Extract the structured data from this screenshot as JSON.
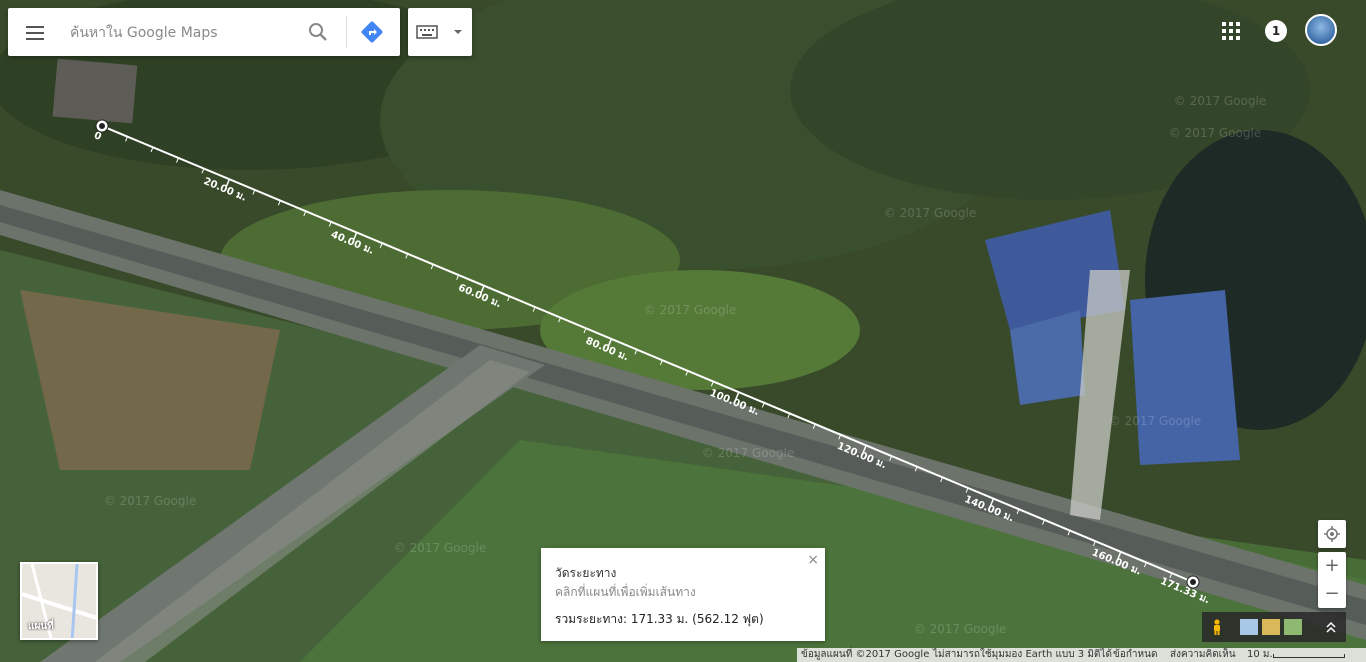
{
  "search": {
    "placeholder": "ค้นหาใน Google Maps"
  },
  "notifications": {
    "count": "1"
  },
  "measure": {
    "title": "วัดระยะทาง",
    "hint": "คลิกที่แผนที่เพื่อเพิ่มเส้นทาง",
    "total": "รวมระยะทาง: 171.33 ม. (562.12 ฟุต)",
    "close": "×",
    "ticks": [
      "0",
      "20.00 ม.",
      "40.00 ม.",
      "60.00 ม.",
      "80.00 ม.",
      "100.00 ม.",
      "120.00 ม.",
      "140.00 ม.",
      "160.00 ม."
    ],
    "end_label": "171.33 ม."
  },
  "maptype": {
    "label": "แผนที่"
  },
  "watermark": "© 2017 Google",
  "controls": {
    "zoom_in": "+",
    "zoom_out": "−"
  },
  "footer": {
    "data": "ข้อมูลแผนที่ ©2017 Google",
    "earth": "ไม่สามารถใช้มุมมอง Earth แบบ 3 มิติได้",
    "terms": "ข้อกำหนด",
    "feedback": "ส่งความคิดเห็น",
    "scale": "10 ม."
  },
  "icons": {
    "menu": "hamburger-icon",
    "search": "search-icon",
    "directions": "directions-icon",
    "keyboard": "keyboard-icon",
    "apps": "apps-grid-icon",
    "pegman": "pegman-icon"
  }
}
